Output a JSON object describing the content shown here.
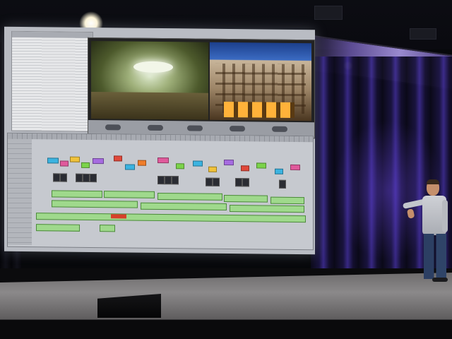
{
  "scene": {
    "type": "photo",
    "subject": "keynote-stage-with-projection-screen",
    "screen_content": "video-editing-timeline",
    "colors": {
      "stage_lighting": "#6a4cff",
      "screen_background": "#b9bcc3",
      "audio_clip": "#9fd98c",
      "presenter_shirt": "#c9ccd2",
      "presenter_jeans": "#2c3f63"
    }
  }
}
